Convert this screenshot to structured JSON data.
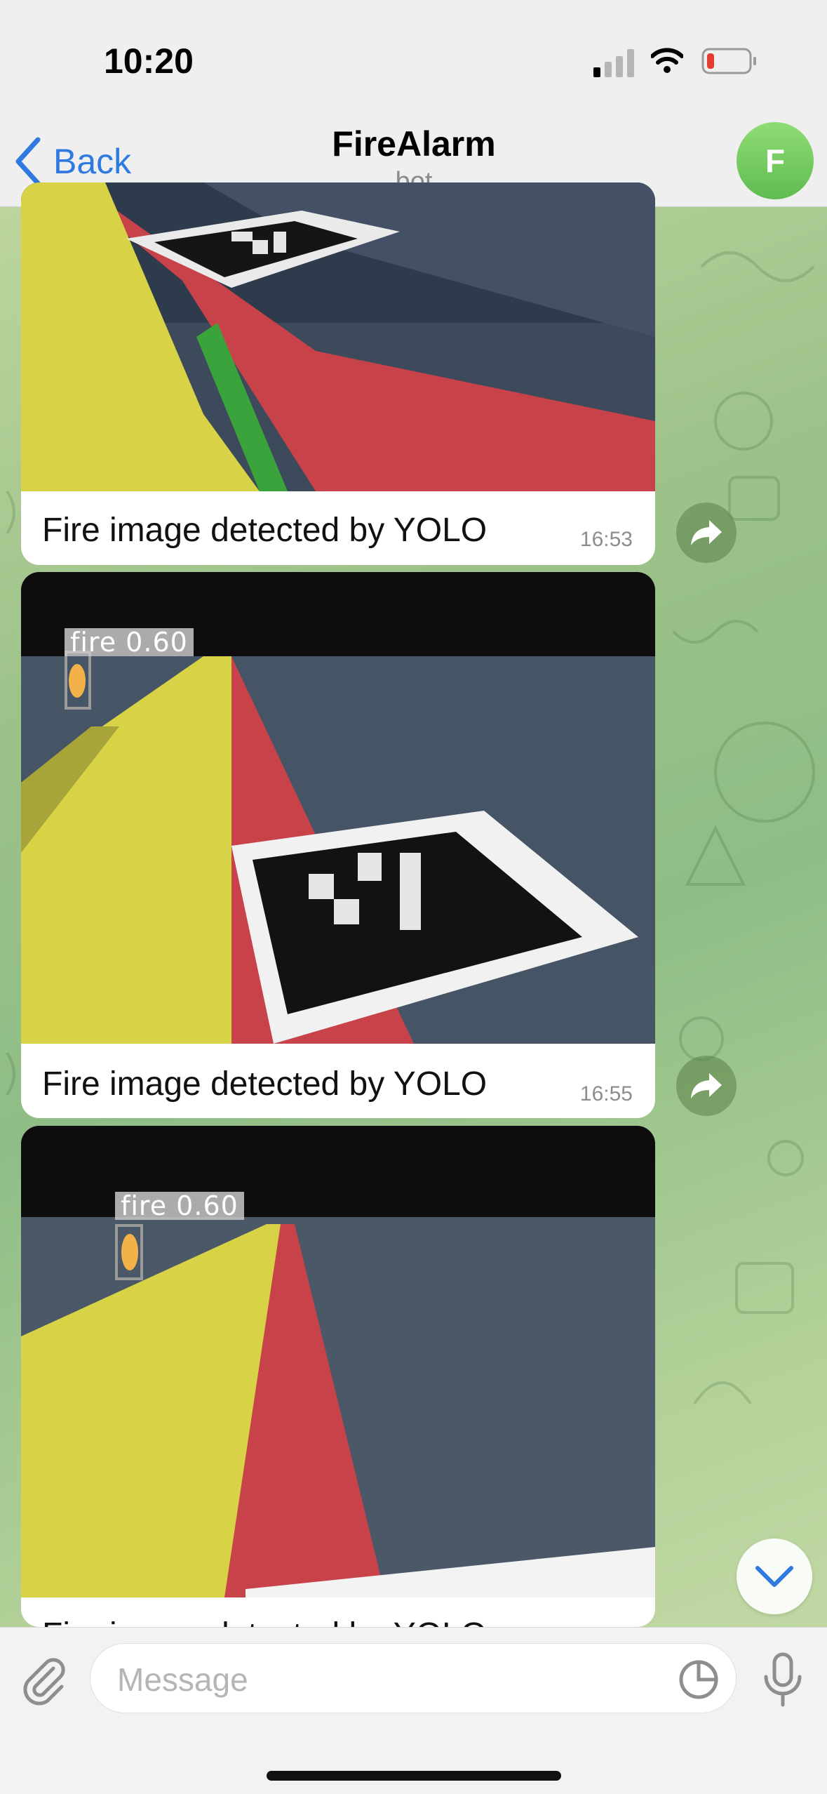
{
  "status_bar": {
    "time": "10:20"
  },
  "header": {
    "back_label": "Back",
    "title": "FireAlarm",
    "subtitle": "bot",
    "avatar_letter": "F"
  },
  "messages": [
    {
      "caption": "Fire image detected by YOLO",
      "time": "16:53",
      "detections": []
    },
    {
      "caption": "Fire image detected by YOLO",
      "time": "16:55",
      "detections": [
        {
          "label": "fire 0.60"
        }
      ]
    },
    {
      "caption": "Fire image detected by YOLO",
      "time": "",
      "detections": [
        {
          "label": "fire 0.60"
        }
      ]
    }
  ],
  "composer": {
    "placeholder": "Message"
  },
  "icons": {
    "back": "chevron-left-icon",
    "forward": "share-arrow-icon",
    "scroll_down": "chevron-down-icon",
    "attach": "paperclip-icon",
    "sticker": "sticker-icon",
    "mic": "microphone-icon"
  },
  "colors": {
    "accent": "#2f7ae0",
    "avatar": "#6fca5e",
    "track_yellow": "#d8d246",
    "track_red": "#c8424a"
  }
}
